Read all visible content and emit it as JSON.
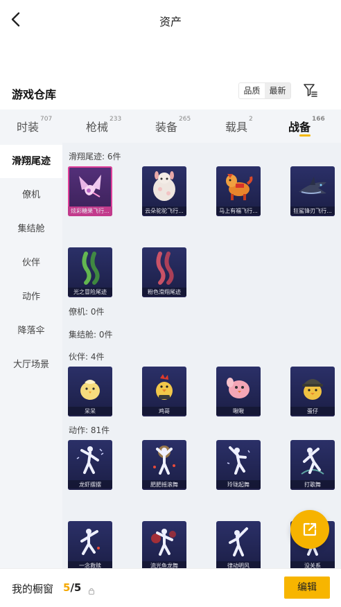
{
  "header": {
    "title": "资产"
  },
  "section": {
    "title": "游戏仓库",
    "sort_options": [
      "品质",
      "最新"
    ]
  },
  "tabs": [
    {
      "label": "时装",
      "count": "707"
    },
    {
      "label": "枪械",
      "count": "233"
    },
    {
      "label": "装备",
      "count": "265"
    },
    {
      "label": "载具",
      "count": "2"
    },
    {
      "label": "战备",
      "count": "166"
    }
  ],
  "active_tab": "战备",
  "sidebar": {
    "items": [
      {
        "label": "滑翔尾迹"
      },
      {
        "label": "僚机"
      },
      {
        "label": "集结舱"
      },
      {
        "label": "伙伴"
      },
      {
        "label": "动作"
      },
      {
        "label": "降落伞"
      },
      {
        "label": "大厅场景"
      }
    ],
    "active": "滑翔尾迹"
  },
  "groups": {
    "glide": {
      "label": "滑翔尾迹: 6件",
      "items": [
        {
          "name": "炫彩糖果飞行...",
          "icon": "candy-wing-icon"
        },
        {
          "name": "云朵驼驼飞行...",
          "icon": "cloud-alpaca-icon"
        },
        {
          "name": "马上有福飞行...",
          "icon": "lucky-horse-icon"
        },
        {
          "name": "狂鲨锋刃飞行...",
          "icon": "shark-blade-icon"
        },
        {
          "name": "光之冒险尾迹",
          "icon": "green-trail-icon"
        },
        {
          "name": "粉色滑翔尾迹",
          "icon": "pink-trail-icon"
        }
      ]
    },
    "wingman": {
      "label": "僚机: 0件"
    },
    "pod": {
      "label": "集结舱: 0件"
    },
    "partner": {
      "label": "伙伴: 4件",
      "items": [
        {
          "name": "呆呆",
          "icon": "chick-icon"
        },
        {
          "name": "鸡哥",
          "icon": "rooster-icon"
        },
        {
          "name": "啾啾",
          "icon": "pink-bird-icon"
        },
        {
          "name": "蛋仔",
          "icon": "helmet-chick-icon"
        }
      ]
    },
    "emote": {
      "label": "动作: 81件",
      "items": [
        {
          "name": "龙虾摆摆",
          "icon": "dance-figure-icon"
        },
        {
          "name": "肥肥摇滚舞",
          "icon": "dance-figure-icon"
        },
        {
          "name": "玲珑起舞",
          "icon": "dance-figure-icon"
        },
        {
          "name": "打歌舞",
          "icon": "dance-figure-icon"
        },
        {
          "name": "一念救赎",
          "icon": "dance-figure-icon"
        },
        {
          "name": "流光鱼龙舞",
          "icon": "dance-figure-icon"
        },
        {
          "name": "律动明风",
          "icon": "dance-figure-icon"
        },
        {
          "name": "没关系",
          "icon": "dance-figure-icon"
        }
      ]
    }
  },
  "bottom": {
    "showcase_label": "我的橱窗",
    "showcase_current": "5",
    "showcase_separator": "/",
    "showcase_total": "5",
    "edit_label": "编辑"
  },
  "colors": {
    "accent": "#f5b800",
    "card_bg": "#22265a",
    "highlight": "#e0409a"
  }
}
